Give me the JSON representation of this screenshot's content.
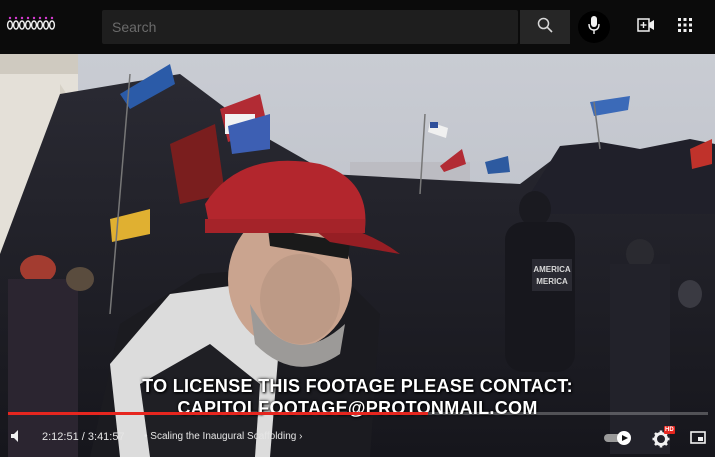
{
  "search": {
    "placeholder": "Search"
  },
  "overlay": {
    "line1": "TO LICENSE THIS FOOTAGE PLEASE CONTACT:",
    "line2": "CAPITOLFOOTAGE@PROTONMAIL.COM"
  },
  "player": {
    "current_time": "2:12:51",
    "separator": "/",
    "duration": "3:41:57",
    "chapter_bullet": "•",
    "chapter": "Scaling the Inaugural Scaffolding",
    "chapter_arrow": "›",
    "progress": 0.6,
    "hd_badge": "HD",
    "accent_color": "#e6261f"
  },
  "jacket_text": {
    "line1": "AMERICA",
    "line2": "MERICA"
  },
  "icons": {
    "logo": "channel-logo",
    "search": "search-icon",
    "mic": "microphone-icon",
    "create": "create-video-icon",
    "apps": "apps-grid-icon",
    "volume": "volume-icon",
    "autoplay": "autoplay-toggle-icon",
    "settings": "settings-gear-icon",
    "miniplayer": "miniplayer-icon"
  }
}
